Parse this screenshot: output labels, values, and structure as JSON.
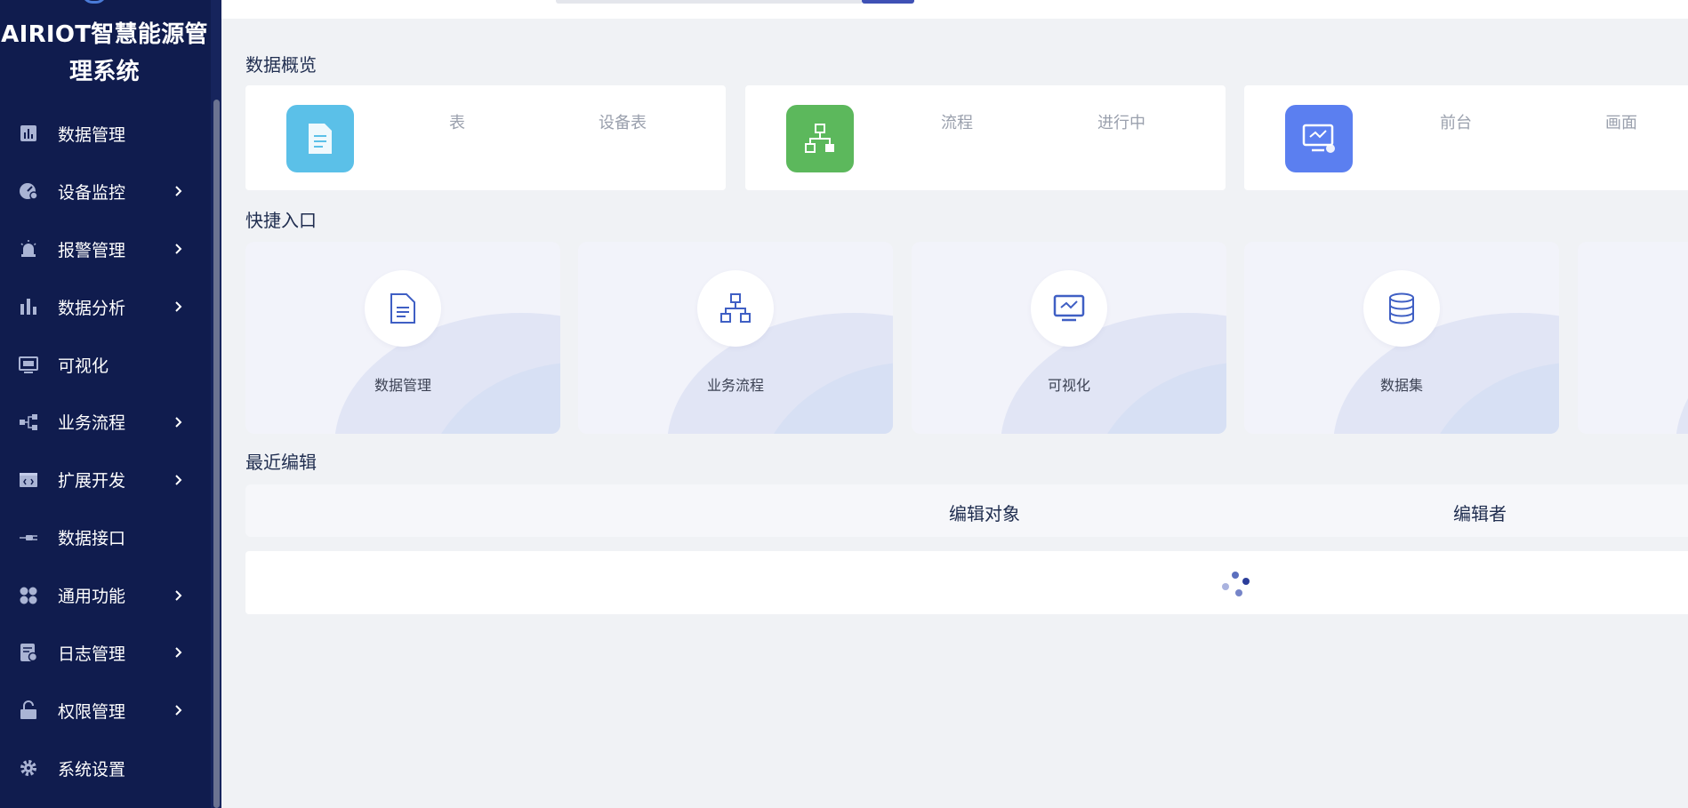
{
  "app": {
    "title": "AIRIOT智慧能源管理系统"
  },
  "sidebar": {
    "items": [
      {
        "label": "数据管理",
        "icon": "bar-chart-icon",
        "has_arrow": false
      },
      {
        "label": "设备监控",
        "icon": "monitor-gauge-icon",
        "has_arrow": true
      },
      {
        "label": "报警管理",
        "icon": "alarm-light-icon",
        "has_arrow": true
      },
      {
        "label": "数据分析",
        "icon": "analysis-bars-icon",
        "has_arrow": true
      },
      {
        "label": "可视化",
        "icon": "screen-icon",
        "has_arrow": false
      },
      {
        "label": "业务流程",
        "icon": "flow-icon",
        "has_arrow": true
      },
      {
        "label": "扩展开发",
        "icon": "code-icon",
        "has_arrow": true
      },
      {
        "label": "数据接口",
        "icon": "plug-icon",
        "has_arrow": false
      },
      {
        "label": "通用功能",
        "icon": "apps-icon",
        "has_arrow": true
      },
      {
        "label": "日志管理",
        "icon": "log-icon",
        "has_arrow": true
      },
      {
        "label": "权限管理",
        "icon": "lock-icon",
        "has_arrow": true
      },
      {
        "label": "系统设置",
        "icon": "gear-icon",
        "has_arrow": false
      }
    ]
  },
  "overview": {
    "title": "数据概览",
    "cards": [
      {
        "icon": "document-icon",
        "color": "#5bc0e8",
        "label_a": "表",
        "label_b": "设备表"
      },
      {
        "icon": "flow-chart-icon",
        "color": "#5cb85c",
        "label_a": "流程",
        "label_b": "进行中"
      },
      {
        "icon": "monitor-icon",
        "color": "#5b7ff0",
        "label_a": "前台",
        "label_b": "画面"
      }
    ]
  },
  "quick_entry": {
    "title": "快捷入口",
    "items": [
      {
        "label": "数据管理",
        "icon": "document-icon"
      },
      {
        "label": "业务流程",
        "icon": "flow-chart-icon"
      },
      {
        "label": "可视化",
        "icon": "monitor-icon"
      },
      {
        "label": "数据集",
        "icon": "database-icon"
      }
    ]
  },
  "recent_edit": {
    "title": "最近编辑",
    "columns": [
      "编辑对象",
      "编辑者"
    ]
  },
  "colors": {
    "sidebar_bg": "#101c4e",
    "accent": "#3f51b5",
    "page_bg": "#f0f2f5"
  }
}
